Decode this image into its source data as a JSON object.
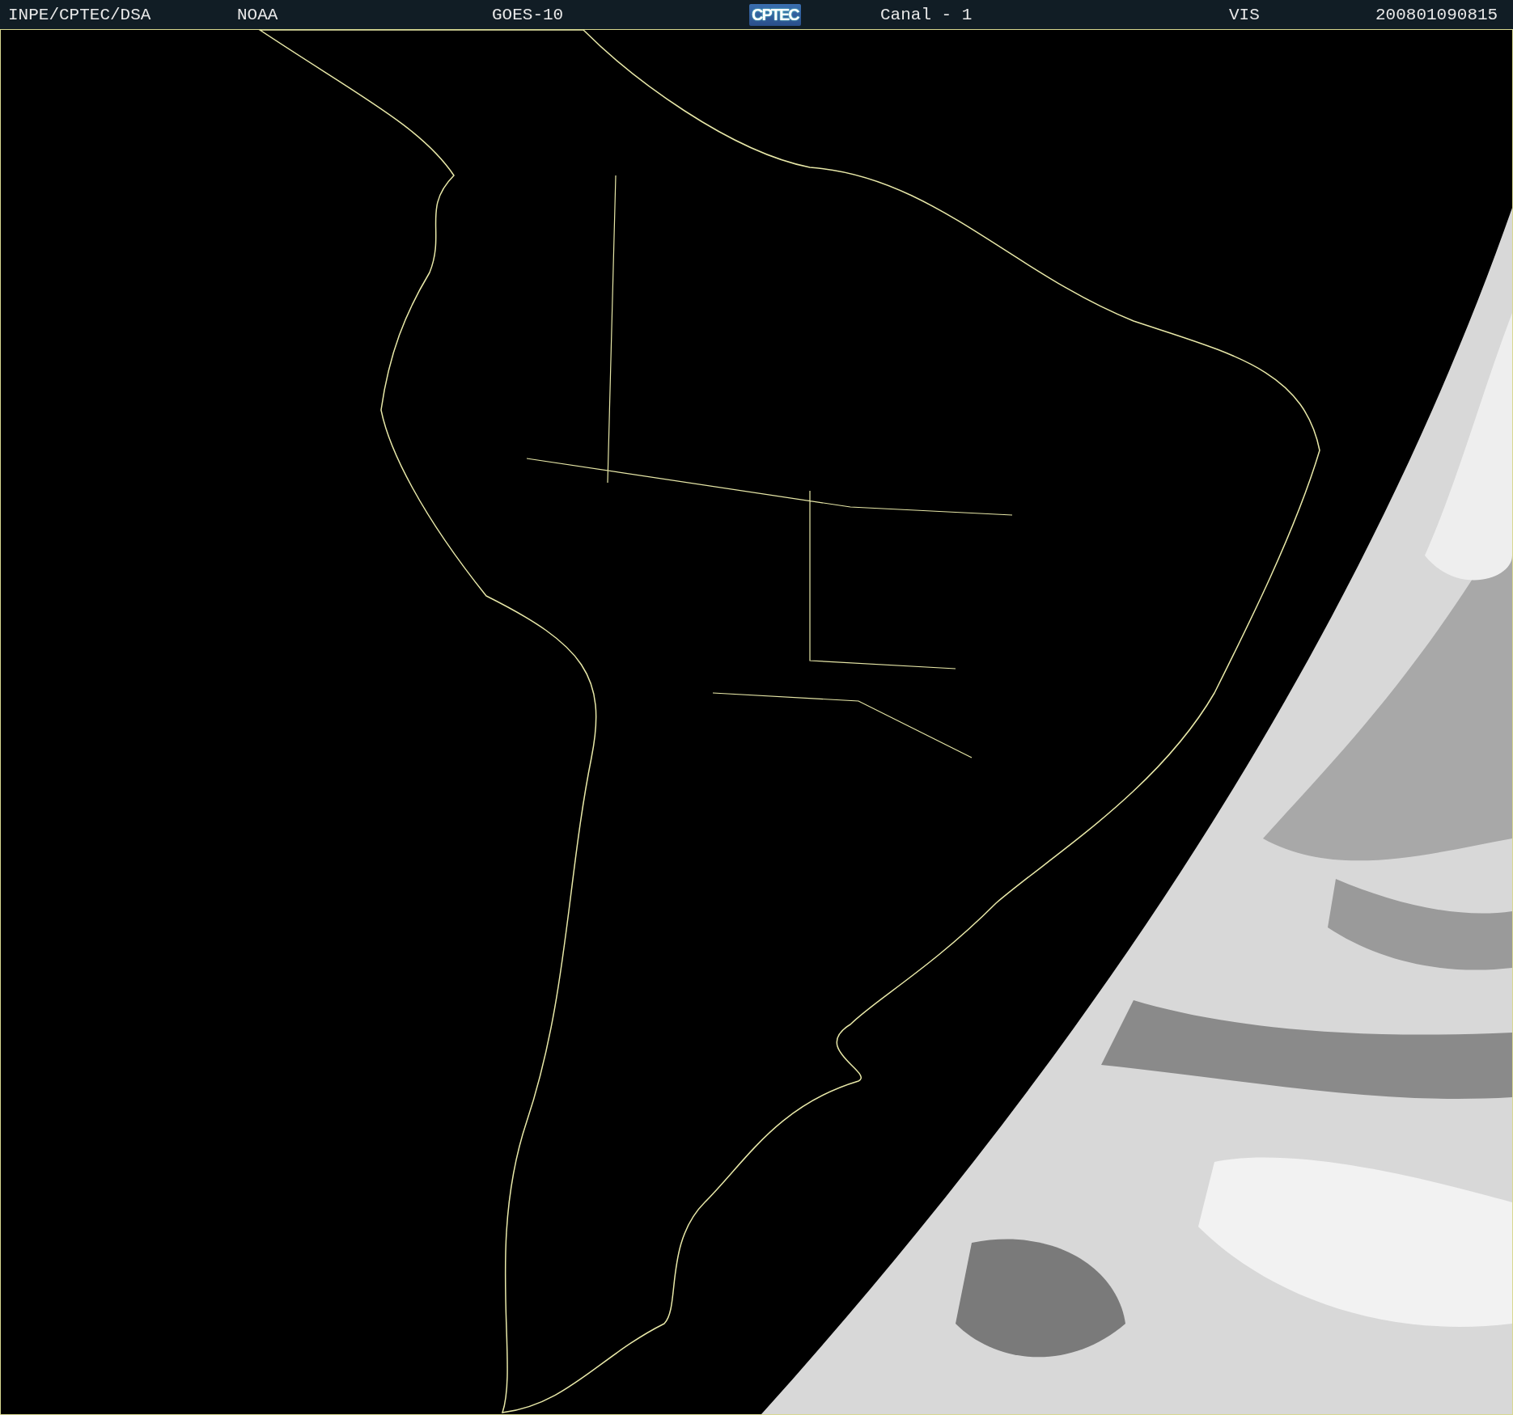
{
  "header": {
    "items": [
      {
        "kind": "text",
        "label": "INPE/CPTEC/DSA"
      },
      {
        "kind": "text",
        "label": "NOAA"
      },
      {
        "kind": "text",
        "label": "GOES-10"
      },
      {
        "kind": "logo",
        "label": "CPTEC"
      },
      {
        "kind": "text",
        "label": "Canal - 1"
      },
      {
        "kind": "text",
        "label": "VIS"
      },
      {
        "kind": "text",
        "label": "200801090815"
      }
    ]
  }
}
